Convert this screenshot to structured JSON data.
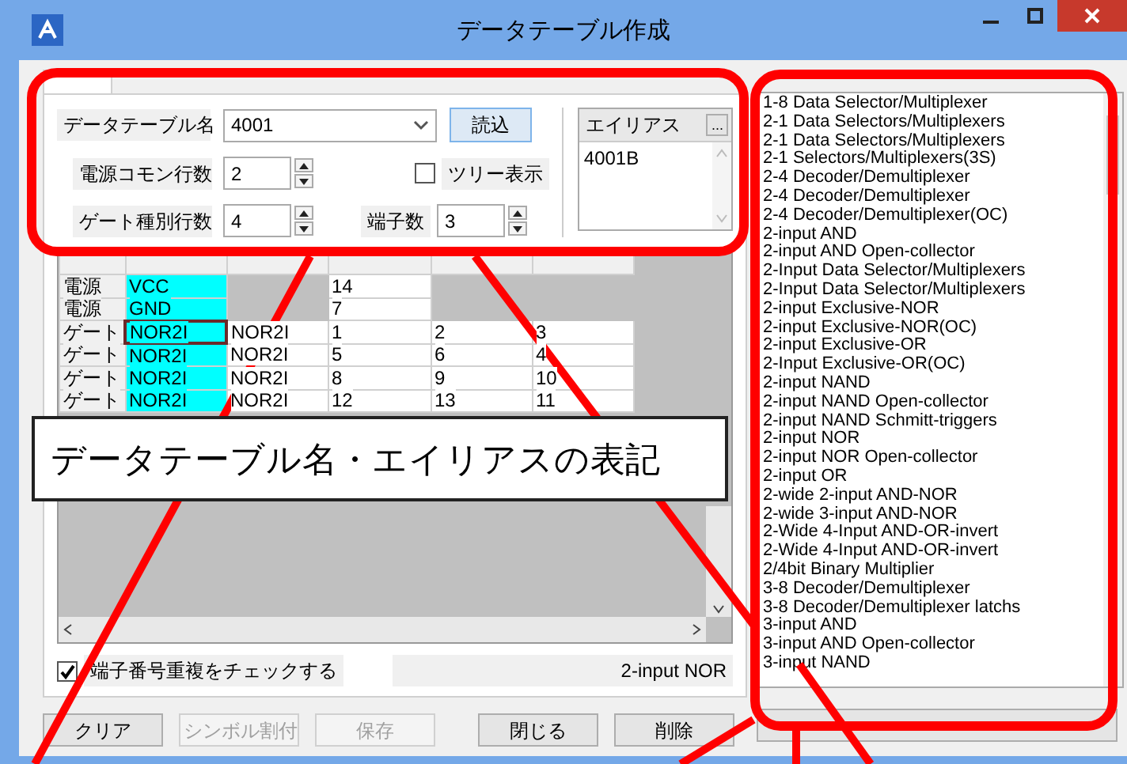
{
  "window": {
    "title": "データテーブル作成"
  },
  "form": {
    "table_name": {
      "label": "データテーブル名",
      "value": "4001"
    },
    "load_button": "読込",
    "power_rows": {
      "label": "電源コモン行数",
      "value": "2"
    },
    "gate_rows": {
      "label": "ゲート種別行数",
      "value": "4"
    },
    "tree_view": {
      "label": "ツリー表示",
      "checked": false
    },
    "pin_count": {
      "label": "端子数",
      "value": "3"
    }
  },
  "alias": {
    "header": "エイリアス",
    "button": "...",
    "items": [
      "4001B"
    ]
  },
  "grid": {
    "rows": [
      {
        "kind": "power",
        "label": "電源",
        "type": "VCC",
        "pins": [
          "14"
        ],
        "selected": false
      },
      {
        "kind": "power",
        "label": "電源",
        "type": "GND",
        "pins": [
          "7"
        ],
        "selected": false
      },
      {
        "kind": "gate",
        "label": "ゲート",
        "type": "NOR2I",
        "symbol": "NOR2I",
        "pins": [
          "1",
          "2",
          "3"
        ],
        "selected": true
      },
      {
        "kind": "gate",
        "label": "ゲート",
        "type": "NOR2I",
        "symbol": "NOR2I",
        "pins": [
          "5",
          "6",
          "4"
        ],
        "selected": false
      },
      {
        "kind": "gate",
        "label": "ゲート",
        "type": "NOR2I",
        "symbol": "NOR2I",
        "pins": [
          "8",
          "9",
          "10"
        ],
        "selected": false
      },
      {
        "kind": "gate",
        "label": "ゲート",
        "type": "NOR2I",
        "symbol": "NOR2I",
        "pins": [
          "12",
          "13",
          "11"
        ],
        "selected": false
      }
    ]
  },
  "check_duplicates": {
    "label": "端子番号重複をチェックする",
    "checked": true
  },
  "status": "2-input NOR",
  "buttons": [
    {
      "label": "クリア",
      "disabled": false
    },
    {
      "label": "シンボル割付",
      "disabled": true
    },
    {
      "label": "保存",
      "disabled": true
    },
    {
      "label": "閉じる",
      "disabled": false
    },
    {
      "label": "削除",
      "disabled": false
    }
  ],
  "type_list": {
    "items": [
      "1-8 Data Selector/Multiplexer",
      "2-1 Data Selectors/Multiplexers",
      "2-1 Data Selectors/Multiplexers",
      "2-1 Selectors/Multiplexers(3S)",
      "2-4 Decoder/Demultiplexer",
      "2-4 Decoder/Demultiplexer",
      "2-4 Decoder/Demultiplexer(OC)",
      "2-input AND",
      "2-input AND Open-collector",
      "2-Input Data Selector/Multiplexers",
      "2-Input Data Selector/Multiplexers",
      "2-input Exclusive-NOR",
      "2-input Exclusive-NOR(OC)",
      "2-input Exclusive-OR",
      "2-Input Exclusive-OR(OC)",
      "2-input NAND",
      "2-input NAND Open-collector",
      "2-input NAND Schmitt-triggers",
      "2-input NOR",
      "2-input NOR Open-collector",
      "2-input OR",
      "2-wide 2-input AND-NOR",
      "2-wide 3-input AND-NOR",
      "2-Wide 4-Input AND-OR-invert",
      "2-Wide 4-Input AND-OR-invert",
      "2/4bit Binary Multiplier",
      "3-8 Decoder/Demultiplexer",
      "3-8 Decoder/Demultiplexer latchs",
      "3-input AND",
      "3-input AND Open-collector",
      "3-input NAND"
    ]
  },
  "annotation": {
    "text": "データテーブル名・エイリアスの表記"
  }
}
